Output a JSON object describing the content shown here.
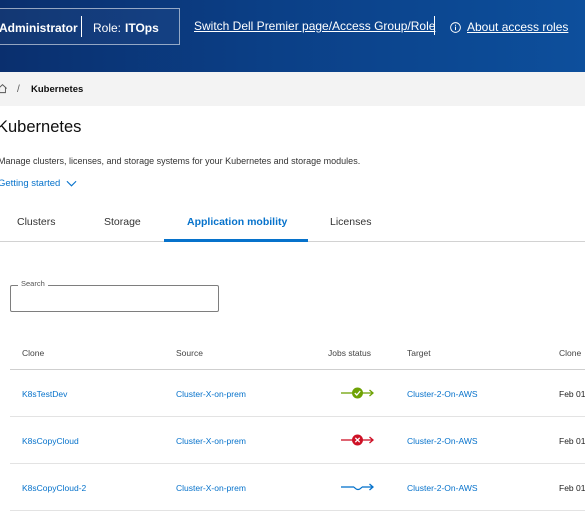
{
  "header": {
    "account": "Administrator",
    "role_label": "Role:",
    "role_value": "ITOps",
    "switch_link": "Switch Dell Premier page/Access Group/Role",
    "about_link": "About access roles",
    "about_icon": "info-circle-icon"
  },
  "breadcrumb": {
    "home_icon": "home-icon",
    "separator": "/",
    "current": "Kubernetes"
  },
  "page": {
    "title": "Kubernetes",
    "description": "Manage clusters, licenses, and storage systems for your Kubernetes and storage modules.",
    "getting_started": "Getting started"
  },
  "tabs": [
    {
      "label": "Clusters",
      "active": false
    },
    {
      "label": "Storage",
      "active": false
    },
    {
      "label": "Application mobility",
      "active": true
    },
    {
      "label": "Licenses",
      "active": false
    }
  ],
  "search": {
    "label": "Search",
    "value": ""
  },
  "table": {
    "columns": [
      "Clone",
      "Source",
      "Jobs status",
      "Target",
      "Clone"
    ],
    "rows": [
      {
        "clone": "K8sTestDev",
        "source": "Cluster-X-on-prem",
        "status": "success",
        "status_color": "#6ea204",
        "target": "Cluster-2-On-AWS",
        "date": "Feb 01"
      },
      {
        "clone": "K8sCopyCloud",
        "source": "Cluster-X-on-prem",
        "status": "failed",
        "status_color": "#ce1126",
        "target": "Cluster-2-On-AWS",
        "date": "Feb 01"
      },
      {
        "clone": "K8sCopyCloud-2",
        "source": "Cluster-X-on-prem",
        "status": "in-progress",
        "status_color": "#0672cb",
        "target": "Cluster-2-On-AWS",
        "date": "Feb 01"
      }
    ]
  },
  "colors": {
    "header_dark": "#0a2f6e",
    "header_light": "#0d4f9c",
    "accent": "#0672cb",
    "success": "#6ea204",
    "error": "#ce1126"
  }
}
